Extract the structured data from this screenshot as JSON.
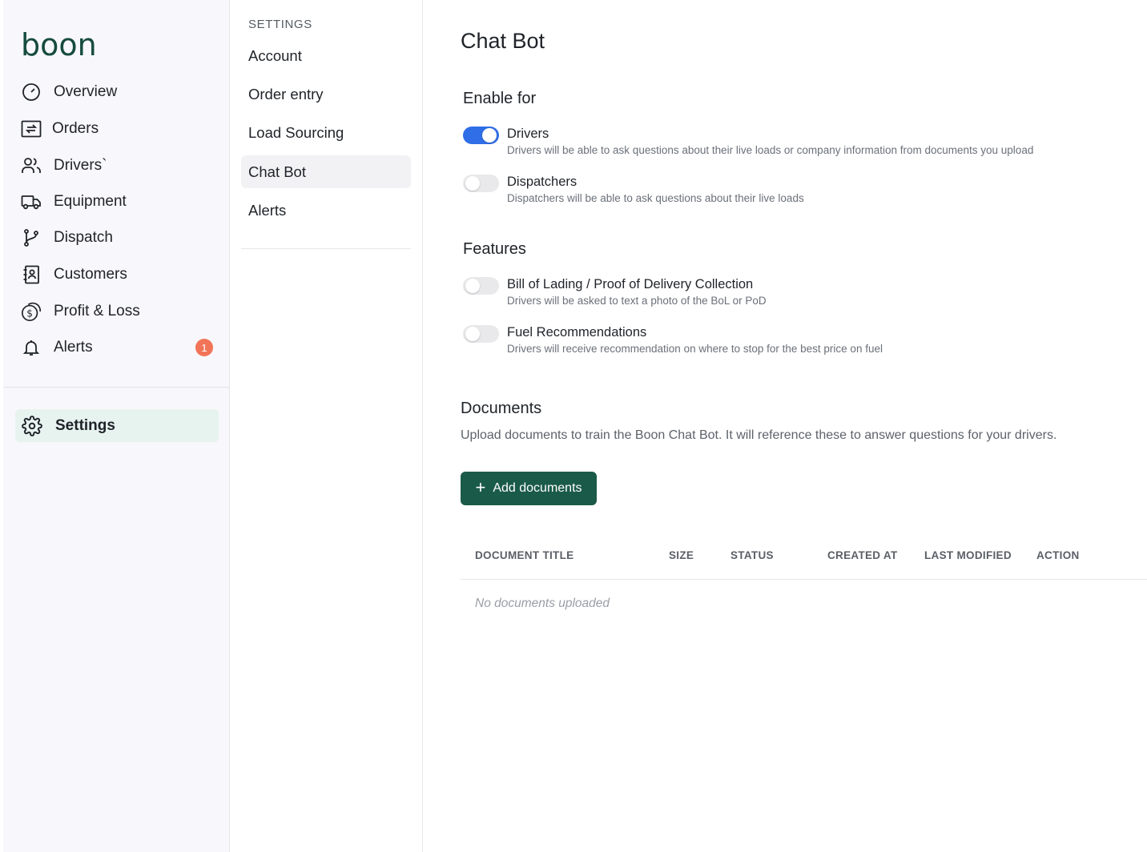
{
  "brand": {
    "logo_text": "boon",
    "color": "#164b3f"
  },
  "sidebar": {
    "items": [
      {
        "label": "Overview",
        "icon": "gauge-icon"
      },
      {
        "label": "Orders",
        "icon": "transfer-icon"
      },
      {
        "label": "Drivers`",
        "icon": "users-icon"
      },
      {
        "label": "Equipment",
        "icon": "truck-icon"
      },
      {
        "label": "Dispatch",
        "icon": "git-branch-icon"
      },
      {
        "label": "Customers",
        "icon": "contact-book-icon"
      },
      {
        "label": "Profit & Loss",
        "icon": "coins-icon"
      },
      {
        "label": "Alerts",
        "icon": "bell-icon",
        "badge": "1"
      }
    ],
    "settings": {
      "label": "Settings",
      "icon": "gear-icon",
      "active": true
    }
  },
  "settings_nav": {
    "heading": "SETTINGS",
    "items": [
      {
        "label": "Account"
      },
      {
        "label": "Order entry"
      },
      {
        "label": "Load Sourcing"
      },
      {
        "label": "Chat Bot",
        "active": true
      },
      {
        "label": "Alerts"
      }
    ]
  },
  "main": {
    "title": "Chat Bot",
    "enable_for": {
      "title": "Enable for",
      "toggles": [
        {
          "label": "Drivers",
          "description": "Drivers will be able to ask questions about their live loads or company information from documents you upload",
          "on": true
        },
        {
          "label": "Dispatchers",
          "description": "Dispatchers will be able to ask questions about their live loads",
          "on": false
        }
      ]
    },
    "features": {
      "title": "Features",
      "toggles": [
        {
          "label": "Bill of Lading / Proof of Delivery Collection",
          "description": "Drivers will be asked to text a photo of the BoL or PoD",
          "on": false
        },
        {
          "label": "Fuel Recommendations",
          "description": "Drivers will receive recommendation on where to stop for the best price on fuel",
          "on": false
        }
      ]
    },
    "documents": {
      "title": "Documents",
      "description": "Upload documents to train the Boon Chat Bot. It will reference these to answer questions for your drivers.",
      "add_button": "Add documents",
      "columns": [
        "DOCUMENT TITLE",
        "SIZE",
        "STATUS",
        "CREATED AT",
        "LAST MODIFIED",
        "ACTION"
      ],
      "empty_text": "No documents uploaded"
    }
  },
  "colors": {
    "accent_blue": "#2f6ee6",
    "primary_green": "#1a5a48",
    "badge": "#f27458",
    "settings_active_bg": "#e7f3ef"
  }
}
